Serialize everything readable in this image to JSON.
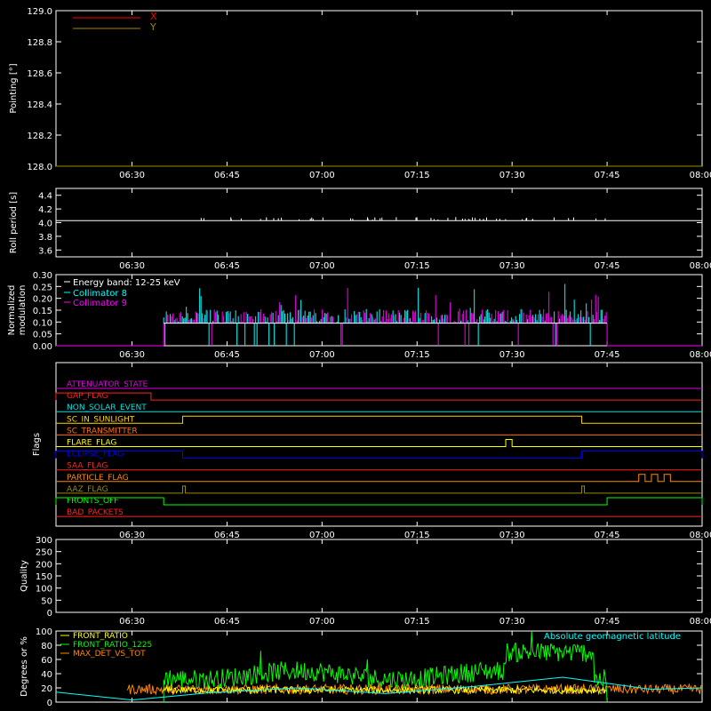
{
  "time_ticks": [
    "06:30",
    "06:45",
    "07:00",
    "07:15",
    "07:30",
    "07:45",
    "08:00"
  ],
  "chart_data": [
    {
      "id": "pointing",
      "type": "line",
      "ylabel": "Pointing [°]",
      "ylim": [
        128.0,
        129.0
      ],
      "yticks": [
        "128.0",
        "128.2",
        "128.4",
        "128.6",
        "128.8",
        "129.0"
      ],
      "xlim": [
        "06:18",
        "08:00"
      ],
      "legend_position": "top-left",
      "series": [
        {
          "name": "X",
          "color": "#ff0000",
          "x": [
            "06:18",
            "08:00"
          ],
          "y": [
            128.0,
            128.0
          ]
        },
        {
          "name": "Y",
          "color": "#9a8a00",
          "x": [
            "06:18",
            "08:00"
          ],
          "y": [
            128.0,
            128.0
          ]
        }
      ]
    },
    {
      "id": "roll",
      "type": "line",
      "ylabel": "Roll period [s]",
      "ylim": [
        3.5,
        4.5
      ],
      "yticks": [
        "3.6",
        "3.8",
        "4.0",
        "4.2",
        "4.4"
      ],
      "xlim": [
        "06:18",
        "08:00"
      ],
      "series": [
        {
          "name": "",
          "color": "#ffffff",
          "x": [
            "06:18",
            "08:00"
          ],
          "y": [
            4.03,
            4.03
          ]
        }
      ]
    },
    {
      "id": "modulation",
      "type": "bar",
      "ylabel": "Normalized modulation",
      "ylim": [
        0.0,
        0.3
      ],
      "yticks": [
        "0.00",
        "0.05",
        "0.10",
        "0.15",
        "0.20",
        "0.25",
        "0.30"
      ],
      "xlim": [
        "06:18",
        "08:00"
      ],
      "annotation": "Energy band: 12-25 keV",
      "active_range": [
        "06:35",
        "07:45"
      ],
      "baseline": 0.095,
      "legend_position": "top-left",
      "series": [
        {
          "name": "Collimator 8",
          "color": "#00ffff"
        },
        {
          "name": "Collimator 9",
          "color": "#ff00ff"
        }
      ]
    },
    {
      "id": "flags",
      "type": "line",
      "ylabel": "Flags",
      "xlim": [
        "06:18",
        "08:00"
      ],
      "series": [
        {
          "name": "ATTENUATOR_STATE",
          "color": "#e000e0",
          "segments": []
        },
        {
          "name": "GAP_FLAG",
          "color": "#ff2020",
          "segments": [
            [
              "06:18",
              "06:33"
            ]
          ]
        },
        {
          "name": "NON_SOLAR_EVENT",
          "color": "#00e0e0",
          "segments": []
        },
        {
          "name": "SC_IN_SUNLIGHT",
          "color": "#ffd000",
          "segments": [
            [
              "06:38",
              "07:41"
            ]
          ]
        },
        {
          "name": "SC_TRANSMITTER",
          "color": "#ff7000",
          "segments": []
        },
        {
          "name": "FLARE_FLAG",
          "color": "#ffff00",
          "segments": [
            [
              "07:29",
              "07:30"
            ]
          ]
        },
        {
          "name": "ECLIPSE_FLAG",
          "color": "#0000ff",
          "segments": [
            [
              "06:18",
              "06:38"
            ],
            [
              "07:41",
              "08:00"
            ]
          ]
        },
        {
          "name": "SAA_FLAG",
          "color": "#ff2020",
          "segments": []
        },
        {
          "name": "PARTICLE_FLAG",
          "color": "#ff8800",
          "segments": [
            [
              "07:50",
              "07:51"
            ],
            [
              "07:52",
              "07:53"
            ],
            [
              "07:54",
              "07:55"
            ]
          ]
        },
        {
          "name": "AAZ_FLAG",
          "color": "#9a8a00",
          "segments": [
            [
              "06:38",
              "06:38"
            ],
            [
              "07:41",
              "07:41"
            ]
          ]
        },
        {
          "name": "FRONTS_OFF",
          "color": "#00ff00",
          "segments": [
            [
              "06:18",
              "06:35"
            ],
            [
              "07:45",
              "08:00"
            ]
          ]
        },
        {
          "name": "BAD_PACKETS",
          "color": "#ff2020",
          "segments": []
        }
      ]
    },
    {
      "id": "quality",
      "type": "line",
      "ylabel": "Quality",
      "ylim": [
        0,
        300
      ],
      "yticks": [
        "0",
        "50",
        "100",
        "150",
        "200",
        "250",
        "300"
      ],
      "xlim": [
        "06:18",
        "08:00"
      ],
      "series": []
    },
    {
      "id": "ratios",
      "type": "line",
      "ylabel": "Degrees or %",
      "ylim": [
        0,
        100
      ],
      "yticks": [
        "0",
        "20",
        "40",
        "60",
        "80",
        "100"
      ],
      "xlim": [
        "06:18",
        "08:00"
      ],
      "legend_position": "top-left",
      "annotation": "Absolute geomagnetic latitude",
      "series": [
        {
          "name": "FRONT_RATIO",
          "color": "#ffff00"
        },
        {
          "name": "FRONT_RATIO_1225",
          "color": "#00ff00"
        },
        {
          "name": "MAX_DET_VS_TOT",
          "color": "#ff8800"
        },
        {
          "name": "Absolute geomagnetic latitude",
          "color": "#00ffff",
          "x": [
            "06:18",
            "06:30",
            "06:42",
            "06:56",
            "07:10",
            "07:24",
            "07:38",
            "07:52",
            "08:00"
          ],
          "y": [
            14,
            3,
            13,
            20,
            12,
            22,
            35,
            18,
            20
          ]
        }
      ]
    }
  ]
}
